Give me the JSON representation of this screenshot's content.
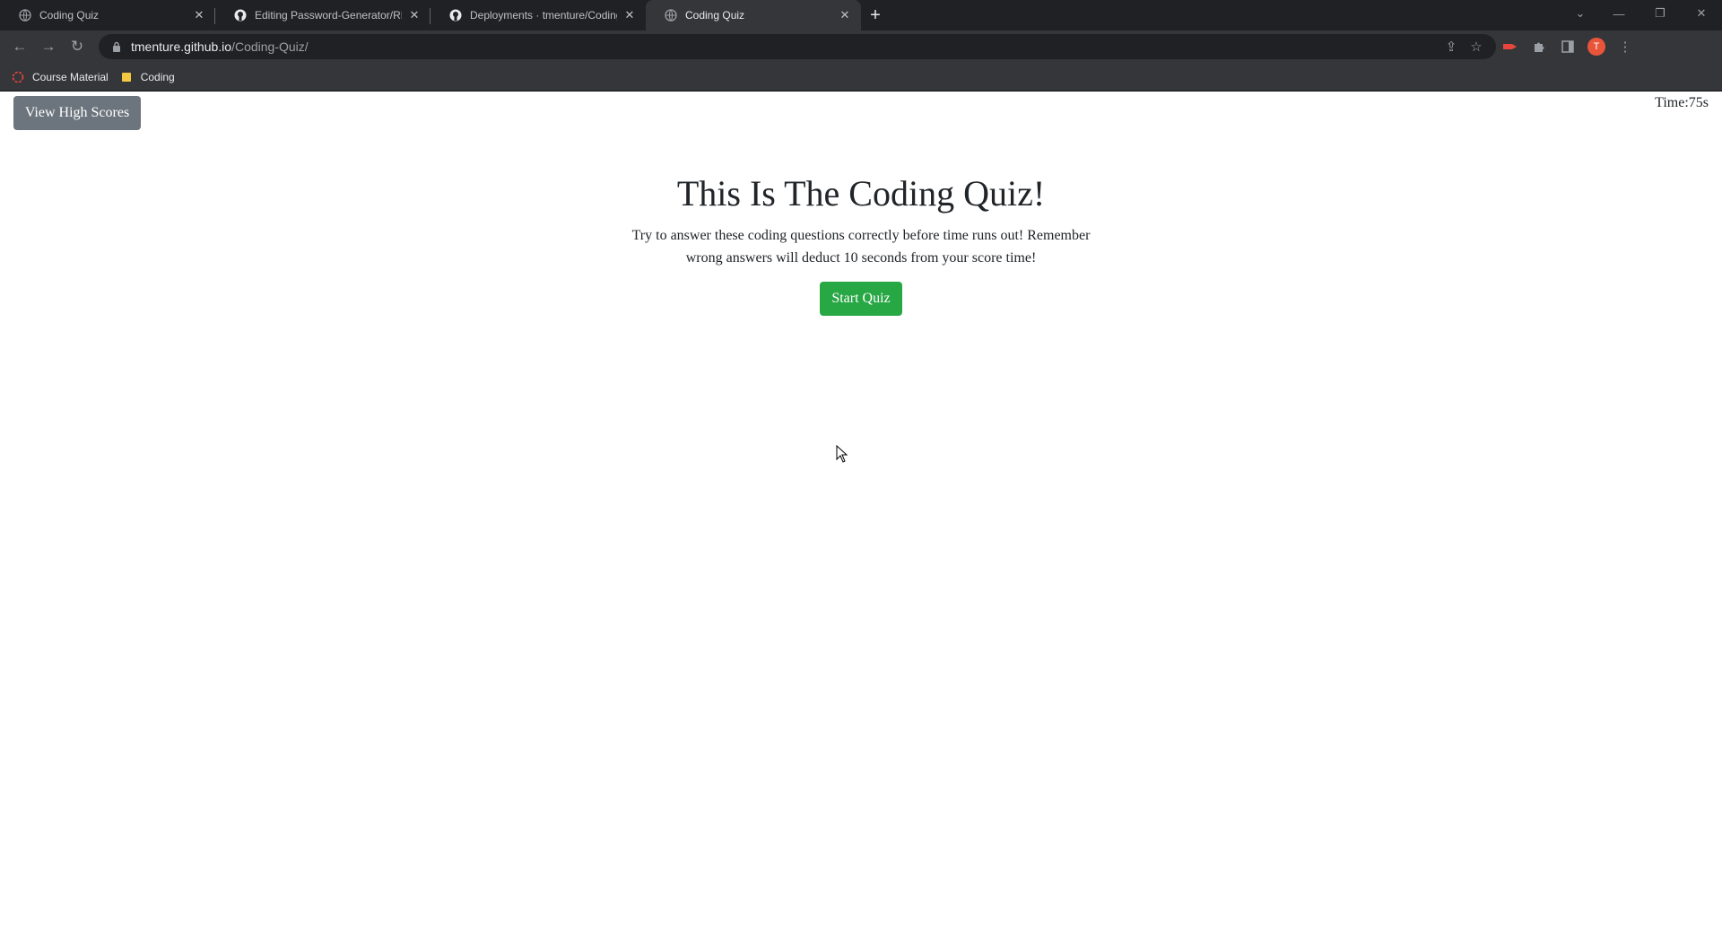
{
  "browser": {
    "tabs": [
      {
        "title": "Coding Quiz",
        "icon": "globe-icon",
        "active": false
      },
      {
        "title": "Editing Password-Generator/RE",
        "icon": "github-icon",
        "active": false
      },
      {
        "title": "Deployments · tmenture/Coding",
        "icon": "github-icon",
        "active": false
      },
      {
        "title": "Coding Quiz",
        "icon": "globe-icon",
        "active": true
      }
    ],
    "url_domain": "tmenture.github.io",
    "url_path": "/Coding-Quiz/",
    "profile_initial": "T",
    "bookmarks": [
      {
        "label": "Course Material",
        "icon": "course-material-icon"
      },
      {
        "label": "Coding",
        "icon": "folder-icon"
      }
    ]
  },
  "page": {
    "high_scores_label": "View High Scores",
    "timer_label": "Time:",
    "timer_value": "75s",
    "title": "This Is The Coding Quiz!",
    "description_line1": "Try to answer these coding questions correctly before time runs out! Remember",
    "description_line2": "wrong answers will deduct 10 seconds from your score time!",
    "start_label": "Start Quiz"
  },
  "colors": {
    "high_scores_button": "#6c757d",
    "start_button": "#28a745",
    "avatar": "#e8553a"
  }
}
